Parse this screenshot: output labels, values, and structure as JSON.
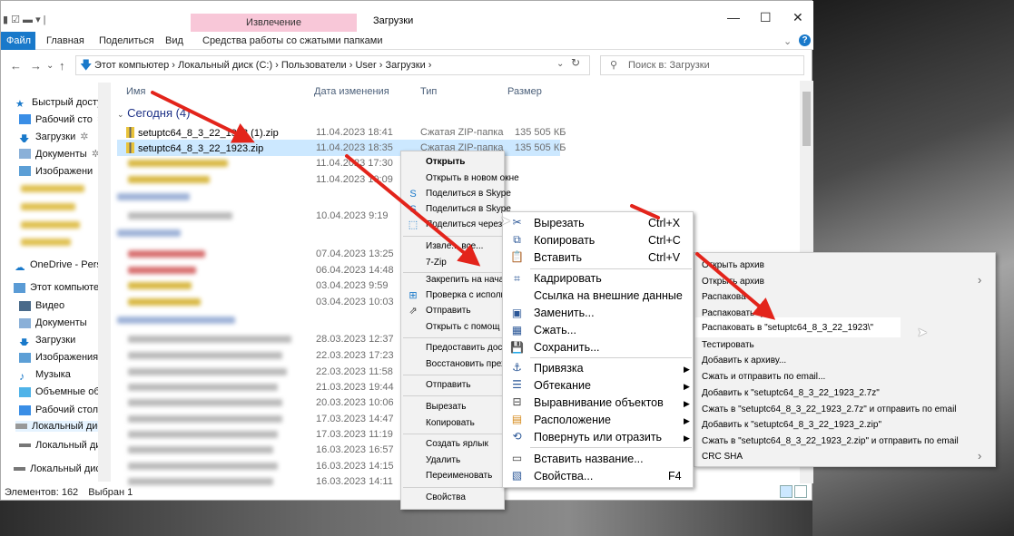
{
  "window": {
    "title": "Загрузки",
    "contextual_tab_header": "Извлечение",
    "controls": [
      "—",
      "☐",
      "✕"
    ]
  },
  "ribbon": {
    "tabs": [
      "Файл",
      "Главная",
      "Поделиться",
      "Вид",
      "Средства работы со сжатыми папками"
    ],
    "help": "?"
  },
  "address_bar": {
    "path": "Этот компьютер  ›  Локальный диск (C:)  ›  Пользователи  ›  User  ›  Загрузки  ›",
    "search_placeholder": "Поиск в: Загрузки"
  },
  "navigation": {
    "items": [
      {
        "label": "Быстрый доступ",
        "icon": "star-icon"
      },
      {
        "label": "Рабочий сто",
        "icon": "desktop-icon"
      },
      {
        "label": "Загрузки",
        "icon": "download-icon"
      },
      {
        "label": "Документы",
        "icon": "document-icon"
      },
      {
        "label": "Изображени",
        "icon": "pictures-icon"
      },
      {
        "label": "OneDrive - Persor",
        "icon": "cloud-icon"
      },
      {
        "label": "Этот компьютер",
        "icon": "computer-icon"
      },
      {
        "label": "Видео",
        "icon": "video-icon"
      },
      {
        "label": "Документы",
        "icon": "document-icon"
      },
      {
        "label": "Загрузки",
        "icon": "download-icon"
      },
      {
        "label": "Изображения",
        "icon": "pictures-icon"
      },
      {
        "label": "Музыка",
        "icon": "music-icon"
      },
      {
        "label": "Объемные объ",
        "icon": "cube-icon"
      },
      {
        "label": "Рабочий стол",
        "icon": "desktop-icon"
      },
      {
        "label": "Локальный дис",
        "icon": "drive-icon"
      },
      {
        "label": "Локальный дис",
        "icon": "drive-icon"
      },
      {
        "label": "Локальный диск",
        "icon": "drive-icon"
      }
    ]
  },
  "columns": {
    "name": "Имя",
    "date": "Дата изменения",
    "type": "Тип",
    "size": "Размер"
  },
  "groups": {
    "today": "Сегодня (4)"
  },
  "files": [
    {
      "name": "setuptc64_8_3_22_1923 (1).zip",
      "date": "11.04.2023 18:41",
      "type": "Сжатая ZIP-папка",
      "size": "135 505 КБ"
    },
    {
      "name": "setuptc64_8_3_22_1923.zip",
      "date": "11.04.2023 18:35",
      "type": "Сжатая ZIP-папка",
      "size": "135 505 КБ"
    }
  ],
  "visible_dates": [
    "11.04.2023 17:30",
    "11.04.2023 10:09",
    "10.04.2023 9:19",
    "07.04.2023 13:25",
    "06.04.2023 14:48",
    "03.04.2023 9:59",
    "03.04.2023 10:03",
    "28.03.2023 12:37",
    "22.03.2023 17:23",
    "22.03.2023 11:58",
    "21.03.2023 19:44",
    "20.03.2023 10:06",
    "17.03.2023 14:47",
    "17.03.2023 11:19",
    "16.03.2023 16:57",
    "16.03.2023 14:15",
    "16.03.2023 14:11"
  ],
  "status_bar": {
    "count": "Элементов: 162",
    "selected": "Выбран 1"
  },
  "context_menu": [
    {
      "label": "Открыть",
      "bold": true
    },
    {
      "label": "Открыть в новом окне"
    },
    {
      "label": "Поделиться в Skype",
      "icon": "skype-icon"
    },
    {
      "label": "Поделиться в Skype",
      "icon": "skype-icon"
    },
    {
      "label": "Поделиться через",
      "icon": "share-icon"
    },
    {
      "label": "Извле... все..."
    },
    {
      "label": "7-Zip"
    },
    {
      "label": "Закрепить на нача"
    },
    {
      "label": "Проверка с исполь",
      "icon": "defender-icon"
    },
    {
      "label": "Отправить",
      "icon": "send-icon"
    },
    {
      "label": "Открыть с помощ"
    },
    {
      "label": "Предоставить дост"
    },
    {
      "label": "Восстановить прех"
    },
    {
      "label": "Отправить"
    },
    {
      "label": "Вырезать"
    },
    {
      "label": "Копировать"
    },
    {
      "label": "Создать ярлык"
    },
    {
      "label": "Удалить"
    },
    {
      "label": "Переименовать"
    },
    {
      "label": "Свойства"
    }
  ],
  "image_menu": [
    {
      "label": "Вырезать",
      "shortcut": "Ctrl+X",
      "icon": "scissors-icon"
    },
    {
      "label": "Копировать",
      "shortcut": "Ctrl+C",
      "icon": "copy-icon"
    },
    {
      "label": "Вставить",
      "shortcut": "Ctrl+V",
      "icon": "paste-icon"
    },
    {
      "label": "Кадрировать",
      "icon": "crop-icon"
    },
    {
      "label": "Ссылка на внешние данные"
    },
    {
      "label": "Заменить...",
      "icon": "replace-icon"
    },
    {
      "label": "Сжать...",
      "icon": "compress-icon"
    },
    {
      "label": "Сохранить...",
      "icon": "save-icon"
    },
    {
      "label": "Привязка",
      "icon": "anchor-icon",
      "submenu": true
    },
    {
      "label": "Обтекание",
      "icon": "wrap-icon",
      "submenu": true
    },
    {
      "label": "Выравнивание объектов",
      "icon": "align-icon",
      "submenu": true
    },
    {
      "label": "Расположение",
      "icon": "arrange-icon",
      "submenu": true
    },
    {
      "label": "Повернуть или отразить",
      "icon": "rotate-icon",
      "submenu": true
    },
    {
      "label": "Вставить название...",
      "icon": "caption-icon"
    },
    {
      "label": "Свойства...",
      "shortcut": "F4",
      "icon": "properties-icon"
    }
  ],
  "zip_menu": [
    {
      "label": "Открыть архив"
    },
    {
      "label": "Открыть архив",
      "submenu": true
    },
    {
      "label": "Распакова"
    },
    {
      "label": "Распаковать зде"
    },
    {
      "label": "Распаковать в \"setuptc64_8_3_22_1923\\\"",
      "highlighted": true
    },
    {
      "label": "Тестировать"
    },
    {
      "label": "Добавить к архиву..."
    },
    {
      "label": "Сжать и отправить по email..."
    },
    {
      "label": "Добавить к \"setuptc64_8_3_22_1923_2.7z\""
    },
    {
      "label": "Сжать в \"setuptc64_8_3_22_1923_2.7z\" и отправить по email"
    },
    {
      "label": "Добавить к \"setuptc64_8_3_22_1923_2.zip\""
    },
    {
      "label": "Сжать в \"setuptc64_8_3_22_1923_2.zip\" и отправить по email"
    },
    {
      "label": "CRC SHA",
      "submenu": true
    }
  ],
  "colors": {
    "accent": "#1979ca",
    "selection": "#cce8ff",
    "arrow": "#e3241b",
    "contextual_tab": "#f8c7d8"
  }
}
